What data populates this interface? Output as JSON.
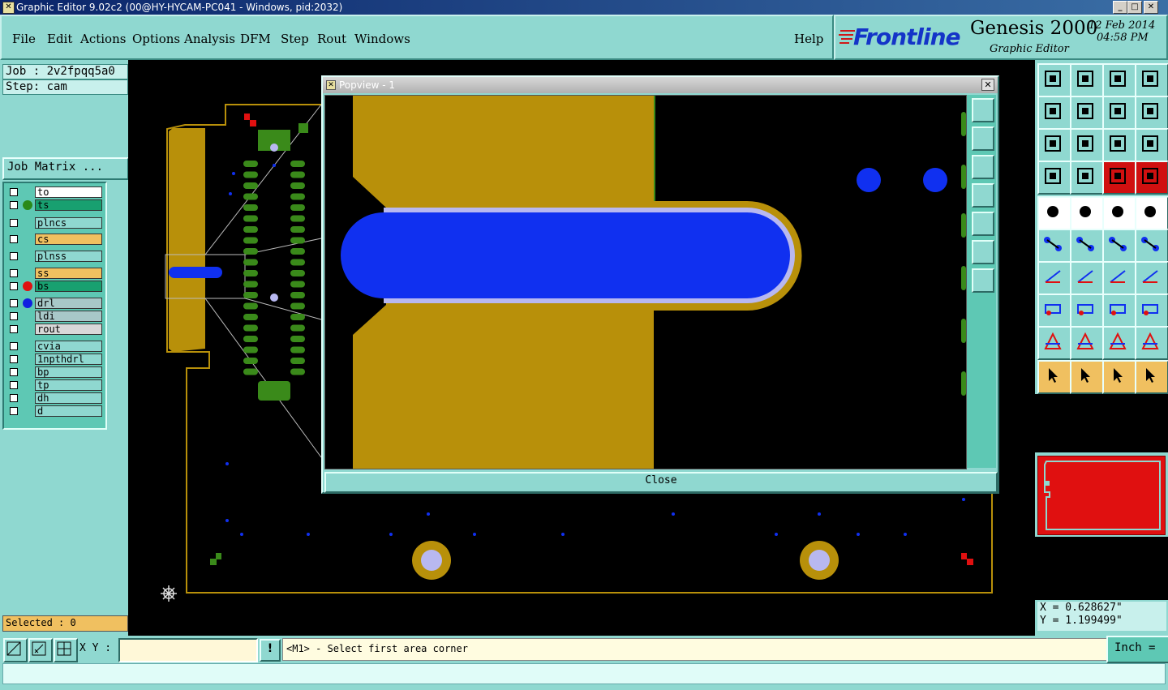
{
  "window": {
    "title": "Graphic Editor 9.02c2 (00@HY-HYCAM-PC041 - Windows, pid:2032)"
  },
  "menu": {
    "items": [
      "File",
      "Edit",
      "Actions",
      "Options",
      "Analysis",
      "DFM",
      "Step",
      "Rout",
      "Windows"
    ],
    "help": "Help"
  },
  "brand": {
    "logo": "Frontline",
    "product": "Genesis 2000",
    "subtitle": "Graphic Editor",
    "date": "12 Feb 2014",
    "time": "04:58 PM"
  },
  "job": {
    "job_label": "Job : 2v2fpqq5a0",
    "step_label": "Step: cam",
    "matrix_button": "Job Matrix ..."
  },
  "layers": [
    {
      "name": "to",
      "color": "#ffffff",
      "dot": ""
    },
    {
      "name": "ts",
      "color": "#18a070",
      "dot": "#2a8a1a"
    },
    {
      "name": "plncs",
      "color": "#8fd8d0",
      "dot": ""
    },
    {
      "name": "cs",
      "color": "#f0c060",
      "dot": ""
    },
    {
      "name": "plnss",
      "color": "#8fd8d0",
      "dot": ""
    },
    {
      "name": "ss",
      "color": "#f0c060",
      "dot": ""
    },
    {
      "name": "bs",
      "color": "#18a070",
      "dot": "#e01010"
    },
    {
      "name": "drl",
      "color": "#a8c8c8",
      "dot": "#1020e0"
    },
    {
      "name": "ldi",
      "color": "#a8c8c8",
      "dot": ""
    },
    {
      "name": "rout",
      "color": "#d8d8d8",
      "dot": ""
    },
    {
      "name": "cvia",
      "color": "#8fd8d0",
      "dot": ""
    },
    {
      "name": "1npthdrl",
      "color": "#8fd8d0",
      "dot": ""
    },
    {
      "name": "bp",
      "color": "#8fd8d0",
      "dot": ""
    },
    {
      "name": "tp",
      "color": "#8fd8d0",
      "dot": ""
    },
    {
      "name": "dh",
      "color": "#8fd8d0",
      "dot": ""
    },
    {
      "name": "d",
      "color": "#8fd8d0",
      "dot": ""
    }
  ],
  "selected": "Selected : 0",
  "popview": {
    "title": "Popview - 1",
    "close": "Close"
  },
  "coords": {
    "x": "X = 0.628627\"",
    "y": "Y = 1.199499\""
  },
  "bottom": {
    "xy_label": "X Y :",
    "xy_value": "",
    "excl": "!",
    "prompt": "<M1> - Select first area corner",
    "unit": "Inch"
  },
  "colors": {
    "copper": "#b8900a",
    "drill": "#1030f0",
    "mask": "#3a8a1a",
    "accent": "#8fd8d0"
  }
}
